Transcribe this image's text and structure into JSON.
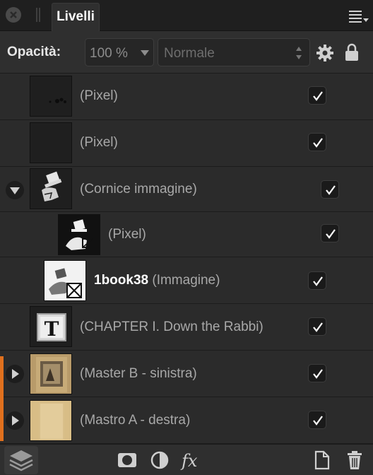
{
  "panel": {
    "tab_label": "Livelli"
  },
  "toolbar": {
    "opacity_label": "Opacità:",
    "opacity_value": "100 %",
    "blend_mode": "Normale"
  },
  "layers": [
    {
      "label": "(Pixel)",
      "bold": "",
      "visible": true,
      "thumb": "pixel-dark-specks"
    },
    {
      "label": "(Pixel)",
      "bold": "",
      "visible": true,
      "thumb": "pixel-empty"
    },
    {
      "label": "(Cornice immagine)",
      "bold": "",
      "visible": true,
      "thumb": "mad-hatter-figure",
      "expanded": true
    },
    {
      "label": "(Pixel)",
      "bold": "",
      "visible": true,
      "thumb": "mad-hatter-crop"
    },
    {
      "label": "(Immagine)",
      "bold": "1book38",
      "visible": true,
      "thumb": "illustration-image"
    },
    {
      "label": "(CHAPTER I. Down the Rabbi)",
      "bold": "",
      "visible": true,
      "thumb": "text-T"
    },
    {
      "label": "(Master B - sinistra)",
      "bold": "",
      "visible": true,
      "thumb": "page-left"
    },
    {
      "label": "(Mastro A - destra)",
      "bold": "",
      "visible": true,
      "thumb": "page-right"
    }
  ],
  "colors": {
    "accent": "#e0701e",
    "panel_bg": "#2b2b2b"
  }
}
